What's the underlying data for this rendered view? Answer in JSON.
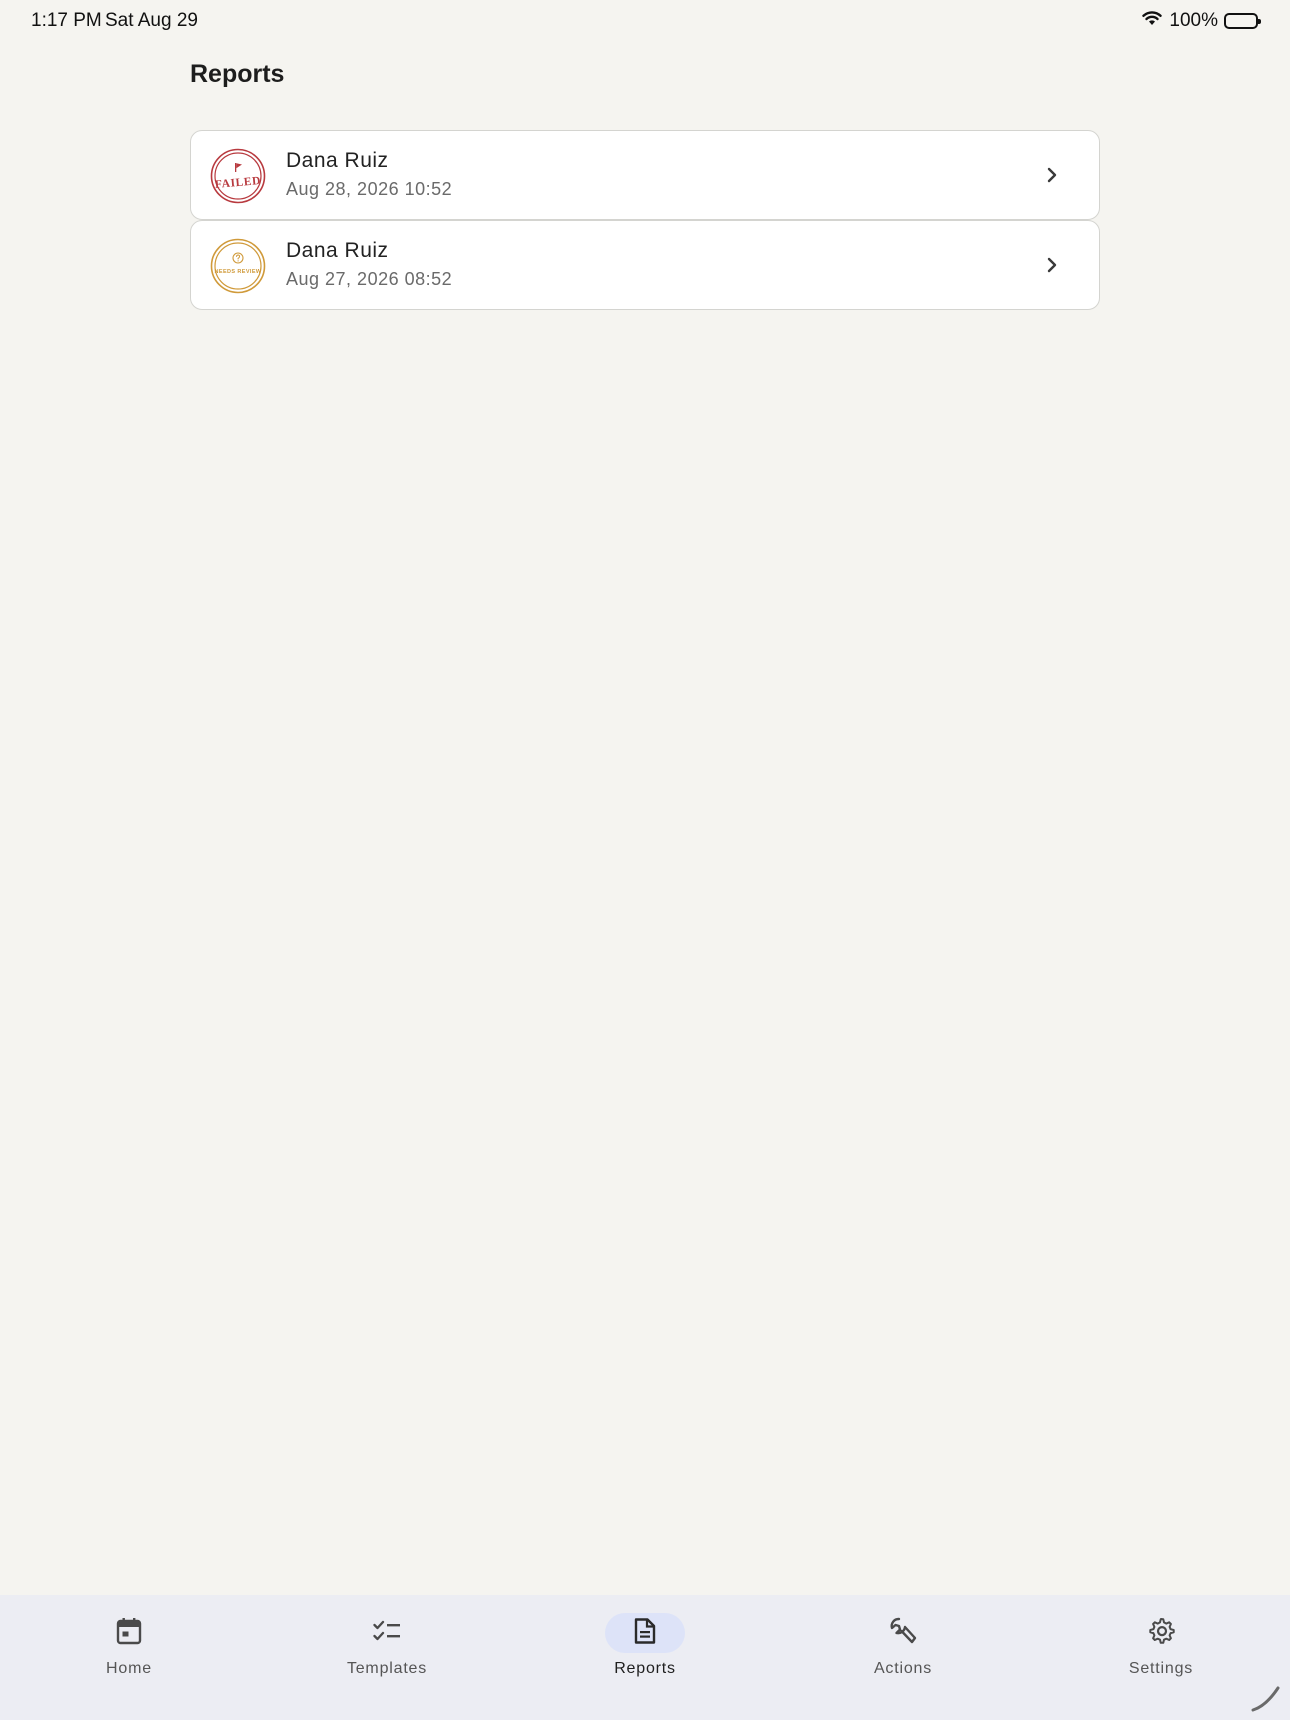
{
  "status_bar": {
    "time": "1:17 PM",
    "date": "Sat Aug 29",
    "battery": "100%"
  },
  "page": {
    "title": "Reports"
  },
  "reports": [
    {
      "name": "Dana Ruiz",
      "date": "Aug 28, 2026 10:52",
      "badge_text": "FAILED",
      "badge_color": "#b83a3f",
      "badge_icon": "flag-icon"
    },
    {
      "name": "Dana Ruiz",
      "date": "Aug 27, 2026 08:52",
      "badge_text": "NEEDS REVIEW",
      "badge_color": "#d09a3a",
      "badge_icon": "question-icon"
    }
  ],
  "nav": {
    "items": [
      {
        "label": "Home",
        "icon": "calendar-icon"
      },
      {
        "label": "Templates",
        "icon": "checklist-icon"
      },
      {
        "label": "Reports",
        "icon": "document-icon",
        "active": true
      },
      {
        "label": "Actions",
        "icon": "wrench-icon"
      },
      {
        "label": "Settings",
        "icon": "gear-icon"
      }
    ]
  },
  "colors": {
    "background": "#f5f4f0",
    "nav_background": "#ecedf3",
    "active_pill": "#dde3f8"
  }
}
